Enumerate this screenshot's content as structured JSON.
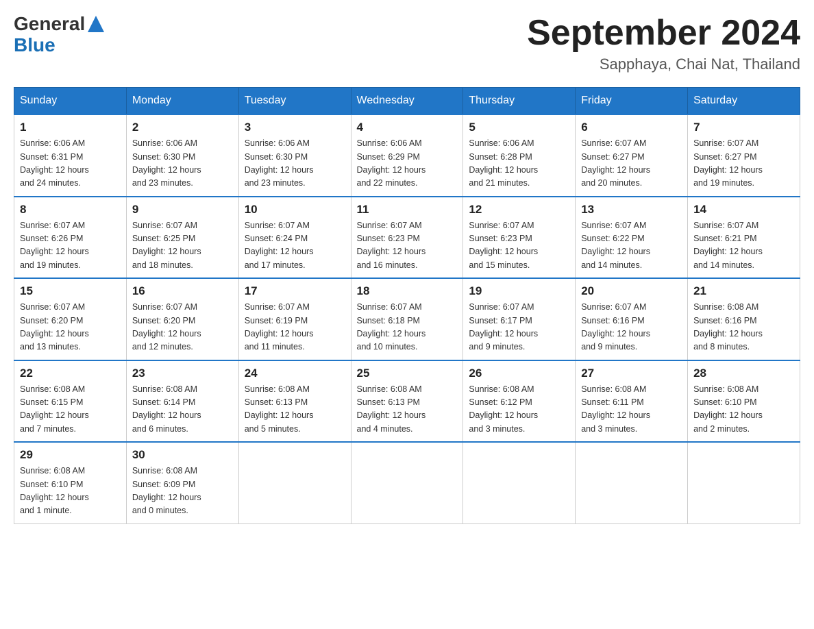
{
  "header": {
    "logo_general": "General",
    "logo_blue": "Blue",
    "title": "September 2024",
    "subtitle": "Sapphaya, Chai Nat, Thailand"
  },
  "days_of_week": [
    "Sunday",
    "Monday",
    "Tuesday",
    "Wednesday",
    "Thursday",
    "Friday",
    "Saturday"
  ],
  "weeks": [
    [
      {
        "day": "1",
        "sunrise": "6:06 AM",
        "sunset": "6:31 PM",
        "daylight": "12 hours and 24 minutes."
      },
      {
        "day": "2",
        "sunrise": "6:06 AM",
        "sunset": "6:30 PM",
        "daylight": "12 hours and 23 minutes."
      },
      {
        "day": "3",
        "sunrise": "6:06 AM",
        "sunset": "6:30 PM",
        "daylight": "12 hours and 23 minutes."
      },
      {
        "day": "4",
        "sunrise": "6:06 AM",
        "sunset": "6:29 PM",
        "daylight": "12 hours and 22 minutes."
      },
      {
        "day": "5",
        "sunrise": "6:06 AM",
        "sunset": "6:28 PM",
        "daylight": "12 hours and 21 minutes."
      },
      {
        "day": "6",
        "sunrise": "6:07 AM",
        "sunset": "6:27 PM",
        "daylight": "12 hours and 20 minutes."
      },
      {
        "day": "7",
        "sunrise": "6:07 AM",
        "sunset": "6:27 PM",
        "daylight": "12 hours and 19 minutes."
      }
    ],
    [
      {
        "day": "8",
        "sunrise": "6:07 AM",
        "sunset": "6:26 PM",
        "daylight": "12 hours and 19 minutes."
      },
      {
        "day": "9",
        "sunrise": "6:07 AM",
        "sunset": "6:25 PM",
        "daylight": "12 hours and 18 minutes."
      },
      {
        "day": "10",
        "sunrise": "6:07 AM",
        "sunset": "6:24 PM",
        "daylight": "12 hours and 17 minutes."
      },
      {
        "day": "11",
        "sunrise": "6:07 AM",
        "sunset": "6:23 PM",
        "daylight": "12 hours and 16 minutes."
      },
      {
        "day": "12",
        "sunrise": "6:07 AM",
        "sunset": "6:23 PM",
        "daylight": "12 hours and 15 minutes."
      },
      {
        "day": "13",
        "sunrise": "6:07 AM",
        "sunset": "6:22 PM",
        "daylight": "12 hours and 14 minutes."
      },
      {
        "day": "14",
        "sunrise": "6:07 AM",
        "sunset": "6:21 PM",
        "daylight": "12 hours and 14 minutes."
      }
    ],
    [
      {
        "day": "15",
        "sunrise": "6:07 AM",
        "sunset": "6:20 PM",
        "daylight": "12 hours and 13 minutes."
      },
      {
        "day": "16",
        "sunrise": "6:07 AM",
        "sunset": "6:20 PM",
        "daylight": "12 hours and 12 minutes."
      },
      {
        "day": "17",
        "sunrise": "6:07 AM",
        "sunset": "6:19 PM",
        "daylight": "12 hours and 11 minutes."
      },
      {
        "day": "18",
        "sunrise": "6:07 AM",
        "sunset": "6:18 PM",
        "daylight": "12 hours and 10 minutes."
      },
      {
        "day": "19",
        "sunrise": "6:07 AM",
        "sunset": "6:17 PM",
        "daylight": "12 hours and 9 minutes."
      },
      {
        "day": "20",
        "sunrise": "6:07 AM",
        "sunset": "6:16 PM",
        "daylight": "12 hours and 9 minutes."
      },
      {
        "day": "21",
        "sunrise": "6:08 AM",
        "sunset": "6:16 PM",
        "daylight": "12 hours and 8 minutes."
      }
    ],
    [
      {
        "day": "22",
        "sunrise": "6:08 AM",
        "sunset": "6:15 PM",
        "daylight": "12 hours and 7 minutes."
      },
      {
        "day": "23",
        "sunrise": "6:08 AM",
        "sunset": "6:14 PM",
        "daylight": "12 hours and 6 minutes."
      },
      {
        "day": "24",
        "sunrise": "6:08 AM",
        "sunset": "6:13 PM",
        "daylight": "12 hours and 5 minutes."
      },
      {
        "day": "25",
        "sunrise": "6:08 AM",
        "sunset": "6:13 PM",
        "daylight": "12 hours and 4 minutes."
      },
      {
        "day": "26",
        "sunrise": "6:08 AM",
        "sunset": "6:12 PM",
        "daylight": "12 hours and 3 minutes."
      },
      {
        "day": "27",
        "sunrise": "6:08 AM",
        "sunset": "6:11 PM",
        "daylight": "12 hours and 3 minutes."
      },
      {
        "day": "28",
        "sunrise": "6:08 AM",
        "sunset": "6:10 PM",
        "daylight": "12 hours and 2 minutes."
      }
    ],
    [
      {
        "day": "29",
        "sunrise": "6:08 AM",
        "sunset": "6:10 PM",
        "daylight": "12 hours and 1 minute."
      },
      {
        "day": "30",
        "sunrise": "6:08 AM",
        "sunset": "6:09 PM",
        "daylight": "12 hours and 0 minutes."
      },
      null,
      null,
      null,
      null,
      null
    ]
  ],
  "labels": {
    "sunrise": "Sunrise:",
    "sunset": "Sunset:",
    "daylight": "Daylight:"
  }
}
